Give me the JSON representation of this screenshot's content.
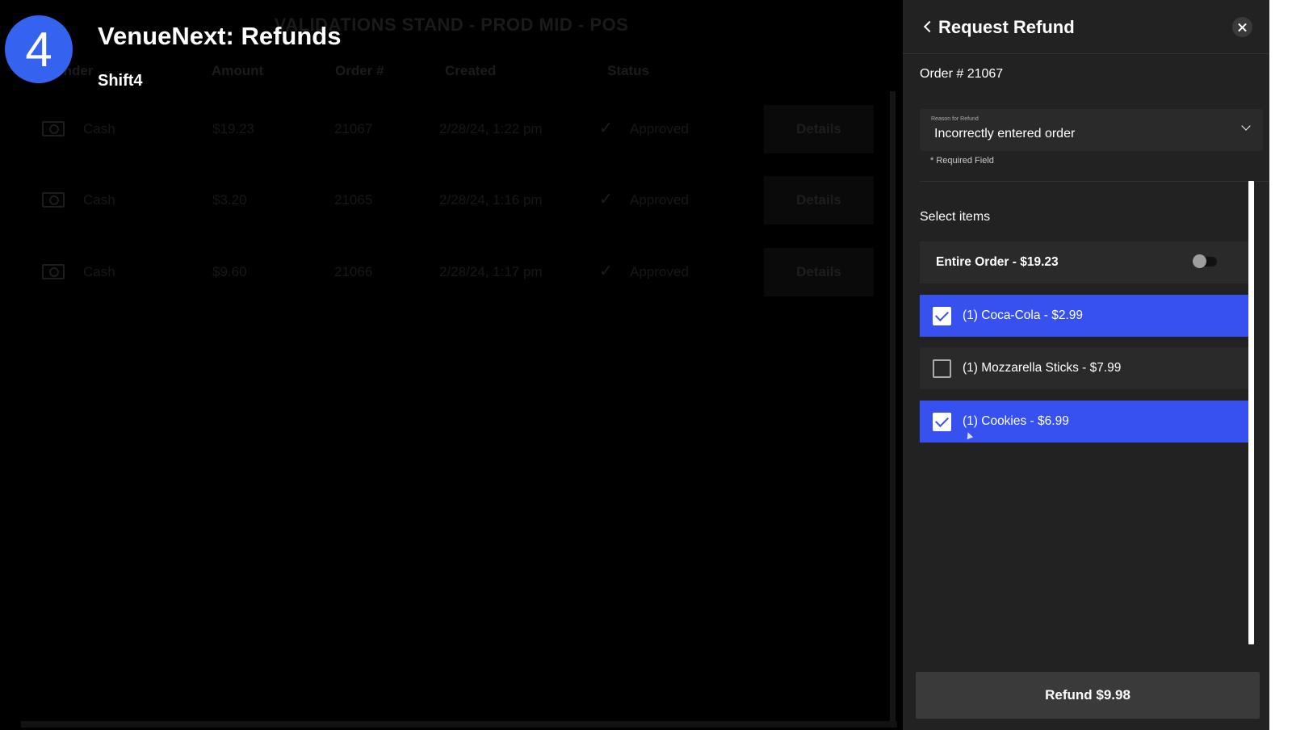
{
  "background": {
    "title": "VALIDATIONS STAND - PROD MID - POS",
    "headers": [
      "Tender",
      "Amount",
      "Order #",
      "Created",
      "Status"
    ],
    "rows": [
      {
        "tender": "Cash",
        "amount": "$19.23",
        "order": "21067",
        "created": "2/28/24, 1:22 pm",
        "status": "Approved",
        "action": "Details"
      },
      {
        "tender": "Cash",
        "amount": "$3.20",
        "order": "21065",
        "created": "2/28/24, 1:16 pm",
        "status": "Approved",
        "action": "Details"
      },
      {
        "tender": "Cash",
        "amount": "$9.60",
        "order": "21066",
        "created": "2/28/24, 1:17 pm",
        "status": "Approved",
        "action": "Details"
      }
    ]
  },
  "branding": {
    "badge": "4",
    "title": "VenueNext: Refunds",
    "subtitle": "Shift4",
    "badge_color": "#3563f0"
  },
  "panel": {
    "title": "Request Refund",
    "order_number": "Order # 21067",
    "reason": {
      "label": "Reason for Refund",
      "value": "Incorrectly entered order",
      "required_note": "* Required Field"
    },
    "select_items_label": "Select items",
    "entire_order": {
      "label": "Entire Order - $19.23",
      "on": false
    },
    "items": [
      {
        "label": "(1) Coca-Cola - $2.99",
        "selected": true
      },
      {
        "label": "(1) Mozzarella Sticks - $7.99",
        "selected": false
      },
      {
        "label": "(1) Cookies - $6.99",
        "selected": true
      }
    ],
    "refund_button": "Refund $9.98",
    "selected_color": "#3751f0"
  }
}
